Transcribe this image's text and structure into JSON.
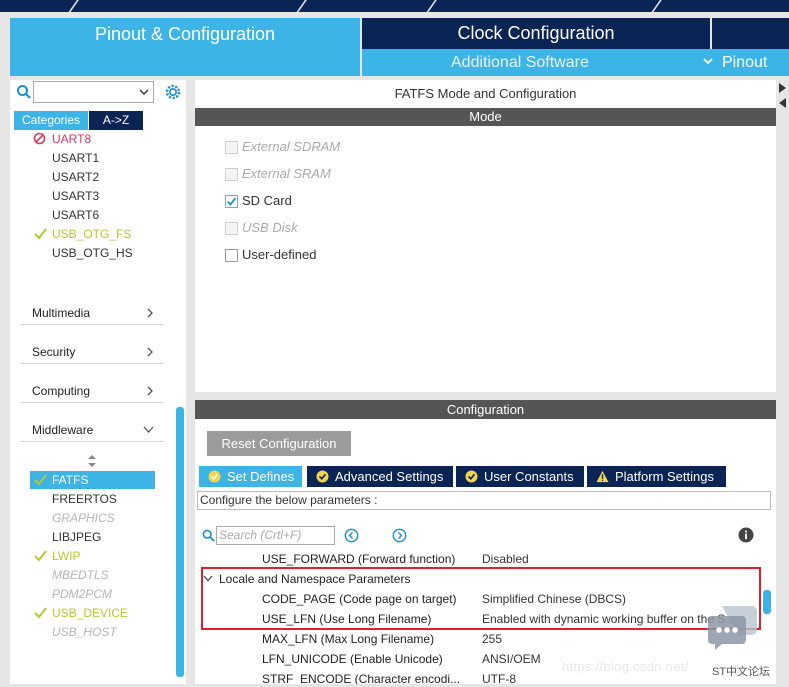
{
  "tabs": {
    "pinout_config": "Pinout & Configuration",
    "clock_config": "Clock Configuration",
    "additional_software": "Additional Software",
    "pinout": "Pinout"
  },
  "left_panel": {
    "search_value": "",
    "tab_categories": "Categories",
    "tab_az": "A->Z",
    "connectivity_items": [
      {
        "label": "UART8",
        "status": "error"
      },
      {
        "label": "USART1",
        "status": "normal"
      },
      {
        "label": "USART2",
        "status": "normal"
      },
      {
        "label": "USART3",
        "status": "normal"
      },
      {
        "label": "USART6",
        "status": "normal"
      },
      {
        "label": "USB_OTG_FS",
        "status": "ok"
      },
      {
        "label": "USB_OTG_HS",
        "status": "normal"
      }
    ],
    "categories": [
      "Multimedia",
      "Security",
      "Computing",
      "Middleware"
    ],
    "middleware_items": [
      {
        "label": "FATFS",
        "status": "selected"
      },
      {
        "label": "FREERTOS",
        "status": "normal"
      },
      {
        "label": "GRAPHICS",
        "status": "disabled"
      },
      {
        "label": "LIBJPEG",
        "status": "normal"
      },
      {
        "label": "LWIP",
        "status": "ok"
      },
      {
        "label": "MBEDTLS",
        "status": "disabled"
      },
      {
        "label": "PDM2PCM",
        "status": "disabled"
      },
      {
        "label": "USB_DEVICE",
        "status": "ok"
      },
      {
        "label": "USB_HOST",
        "status": "disabled"
      }
    ]
  },
  "mode_panel": {
    "title": "FATFS Mode and Configuration",
    "section": "Mode",
    "options": [
      {
        "label": "External SDRAM",
        "checked": false,
        "enabled": false
      },
      {
        "label": "External SRAM",
        "checked": false,
        "enabled": false
      },
      {
        "label": "SD Card",
        "checked": true,
        "enabled": true
      },
      {
        "label": "USB Disk",
        "checked": false,
        "enabled": false
      },
      {
        "label": "User-defined",
        "checked": false,
        "enabled": true
      }
    ]
  },
  "config_panel": {
    "section": "Configuration",
    "reset_button": "Reset Configuration",
    "tabs": [
      "Set Defines",
      "Advanced Settings",
      "User Constants",
      "Platform Settings"
    ],
    "description": "Configure the below parameters :",
    "search_placeholder": "Search (Crtl+F)",
    "rows_before": [
      {
        "name": "USE_FORWARD (Forward function)",
        "value": "Disabled"
      }
    ],
    "group_label": "Locale and Namespace Parameters",
    "group_rows": [
      {
        "name": "CODE_PAGE (Code page on target)",
        "value": "Simplified Chinese (DBCS)"
      },
      {
        "name": "USE_LFN (Use Long Filename)",
        "value": "Enabled with dynamic working buffer on the S..."
      },
      {
        "name": "MAX_LFN (Max Long Filename)",
        "value": "255"
      },
      {
        "name": "LFN_UNICODE (Enable Unicode)",
        "value": "ANSI/OEM"
      },
      {
        "name": "STRF_ENCODE (Character encodi...",
        "value": "UTF-8"
      }
    ]
  },
  "watermark": {
    "url": "https://blog.csdn.net/",
    "forum": "ST中文论坛"
  },
  "colors": {
    "accent": "#3cb4e5",
    "navy": "#0b2456",
    "ok": "#b7c72f",
    "error": "#d33a65",
    "highlight": "#e0202a"
  }
}
